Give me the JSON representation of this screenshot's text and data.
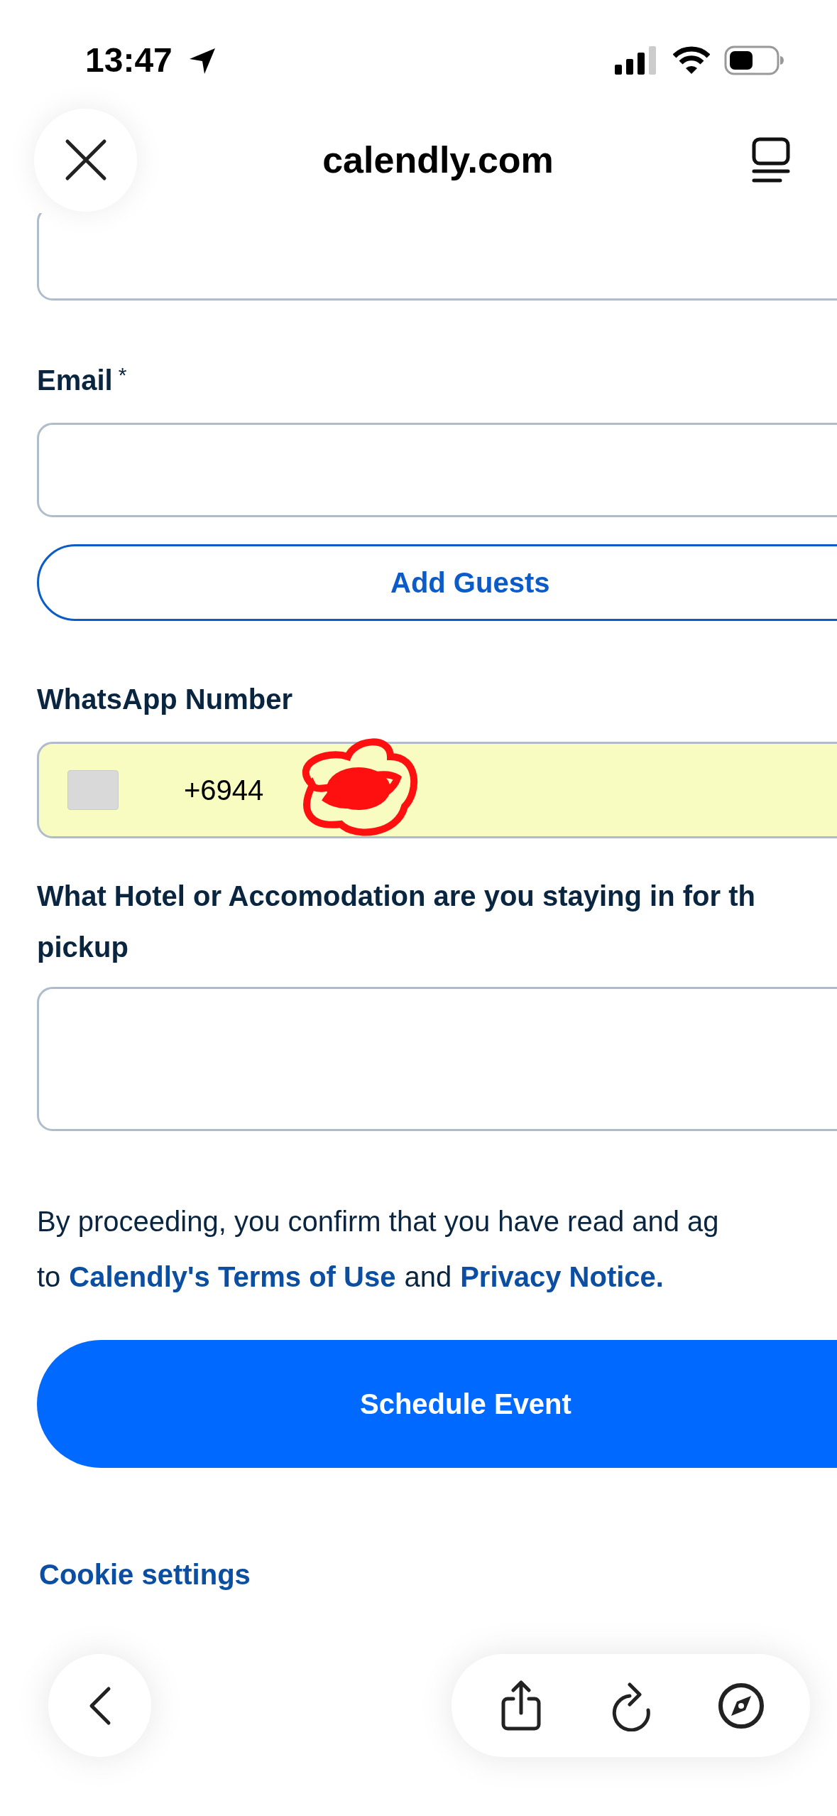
{
  "status_bar": {
    "time": "13:47"
  },
  "browser": {
    "domain": "calendly.com"
  },
  "form": {
    "email_label": "Email",
    "required_mark": "*",
    "add_guests": "Add Guests",
    "whatsapp_label": "WhatsApp Number",
    "whatsapp_value": "+6944",
    "hotel_label": [
      "What Hotel or Accomodation are you staying in for th",
      "pickup"
    ],
    "consent": {
      "line1": "By proceeding, you confirm that you have read and ag",
      "to": "to",
      "terms": "Calendly's Terms of Use",
      "and": "and",
      "privacy": "Privacy Notice."
    },
    "submit": "Schedule Event",
    "cookie": "Cookie settings"
  }
}
